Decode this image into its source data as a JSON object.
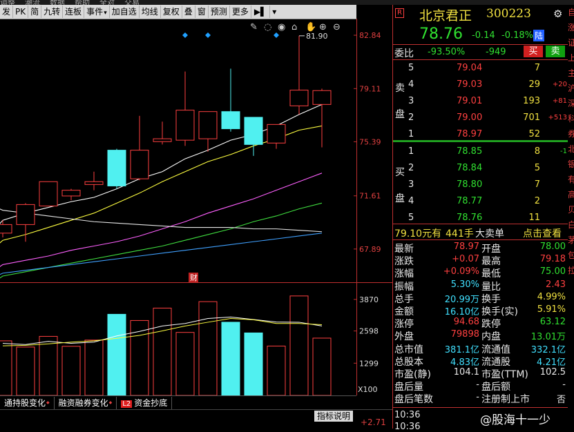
{
  "menubar": [
    "调整",
    "潮流",
    "数据",
    "帮助",
    "全对",
    "交易"
  ],
  "toolbar": {
    "items": [
      "发",
      "PK",
      "简",
      "九转",
      "连板",
      "事件",
      "加自选",
      "均线",
      "复权",
      "叠",
      "窗",
      "预测",
      "更多"
    ],
    "dropdown_items": [
      "事件"
    ]
  },
  "chart_data": {
    "type": "candlestick",
    "price_axis": {
      "ticks": [
        82.84,
        79.11,
        75.39,
        71.61,
        67.89
      ],
      "range": [
        66,
        84
      ]
    },
    "candles": [
      {
        "o": 69.0,
        "h": 69.9,
        "l": 68.7,
        "c": 69.6
      },
      {
        "o": 69.6,
        "h": 71.1,
        "l": 68.4,
        "c": 71.0
      },
      {
        "o": 70.9,
        "h": 72.6,
        "l": 70.9,
        "c": 72.6
      },
      {
        "o": 71.6,
        "h": 72.1,
        "l": 71.3,
        "c": 72.0
      },
      {
        "o": 72.4,
        "h": 73.3,
        "l": 72.0,
        "c": 72.6
      },
      {
        "o": 74.8,
        "h": 74.9,
        "l": 72.1,
        "c": 72.3
      },
      {
        "o": 72.8,
        "h": 77.2,
        "l": 72.7,
        "c": 74.8
      },
      {
        "o": 75.4,
        "h": 76.8,
        "l": 75.2,
        "c": 75.6
      },
      {
        "o": 75.5,
        "h": 80.3,
        "l": 75.1,
        "c": 77.6
      },
      {
        "o": 75.6,
        "h": 77.4,
        "l": 74.7,
        "c": 77.5
      },
      {
        "o": 77.5,
        "h": 80.5,
        "l": 76.1,
        "c": 76.3
      },
      {
        "o": 77.1,
        "h": 77.1,
        "l": 74.4,
        "c": 75.2
      },
      {
        "o": 75.3,
        "h": 76.5,
        "l": 74.9,
        "c": 76.6
      },
      {
        "o": 77.9,
        "h": 82.8,
        "l": 77.3,
        "c": 79.0
      },
      {
        "o": 78.0,
        "h": 79.1,
        "l": 75.0,
        "c": 78.97
      }
    ],
    "high_annotation": "81.90",
    "ma_lines": [
      {
        "color": "#ffffff",
        "values": [
          69.9,
          70.4,
          70.8,
          71.2,
          71.5,
          72.1,
          72.8,
          73.3,
          74.2,
          74.8,
          75.5,
          75.9,
          76.5,
          77.3,
          78.0
        ]
      },
      {
        "color": "#ffff40",
        "values": [
          68.5,
          68.9,
          69.4,
          69.9,
          70.4,
          71.1,
          71.8,
          72.6,
          73.3,
          74.0,
          74.5,
          75.1,
          75.6,
          76.2,
          76.5
        ]
      },
      {
        "color": "#ff60ff",
        "values": [
          66.8,
          67.1,
          67.4,
          67.8,
          68.1,
          68.4,
          68.8,
          69.3,
          69.8,
          70.4,
          70.9,
          71.4,
          72.0,
          72.6,
          73.2
        ]
      },
      {
        "color": "#40e040",
        "values": [
          66.0,
          66.3,
          66.6,
          66.9,
          67.2,
          67.5,
          67.8,
          68.1,
          68.5,
          68.9,
          69.3,
          69.8,
          70.2,
          70.7,
          71.1
        ]
      },
      {
        "color": "#e8e8e8",
        "values": [
          70.6,
          70.4,
          70.2,
          70.0,
          69.8,
          69.7,
          69.6,
          69.5,
          69.4,
          69.4,
          69.4,
          69.3,
          69.3,
          69.2,
          69.1
        ]
      },
      {
        "color": "#40a0ff",
        "values": [
          66.2,
          66.4,
          66.6,
          66.8,
          67.0,
          67.2,
          67.4,
          67.6,
          67.8,
          68.0,
          68.2,
          68.4,
          68.6,
          68.8,
          69.0
        ]
      }
    ],
    "volume_axis": {
      "ticks": [
        3870,
        2598,
        1299
      ],
      "range": [
        0,
        4200
      ],
      "unit": "X100"
    },
    "volumes": [
      2200,
      1950,
      2380,
      1980,
      2230,
      3270,
      3020,
      3520,
      2540,
      3780,
      2950,
      2520,
      1990,
      4010,
      2310
    ],
    "vol_ma": [
      {
        "color": "#ffffff",
        "values": [
          2100,
          2050,
          2180,
          2100,
          2150,
          2400,
          2580,
          2800,
          2900,
          3100,
          3160,
          3060,
          2960,
          2950,
          2800
        ]
      },
      {
        "color": "#ffff40",
        "values": [
          2000,
          2020,
          2080,
          2150,
          2200,
          2300,
          2420,
          2600,
          2800,
          2950,
          3100,
          3050,
          2900,
          2900,
          2850
        ]
      }
    ],
    "markers": {
      "diamonds_at": [
        8,
        9,
        12
      ],
      "cai_label": "财"
    }
  },
  "chart_icons": [
    "pencil-icon",
    "lasso-icon",
    "eye-icon",
    "lock-icon",
    "hand-icon",
    "zoom-in-icon",
    "zoom-out-icon"
  ],
  "tabs": [
    "通持股变化",
    "融资融券变化",
    "资金抄底"
  ],
  "tabs_l2": "L2",
  "index_button": "指标说明",
  "bottom_value": "+2.71",
  "quote": {
    "r_badge": "R",
    "name": "北京君正",
    "code": "300223",
    "price": "78.76",
    "change": "-0.14",
    "change_pct": "-0.18%",
    "exchange_tag": "陆",
    "weibi_label": "委比",
    "weibi_pct": "-93.50%",
    "weibi_val": "-949",
    "buy_btn": "买",
    "sell_btn": "卖",
    "sell_side_label": [
      "卖",
      "盘"
    ],
    "buy_side_label": [
      "买",
      "盘"
    ],
    "asks": [
      {
        "lvl": "5",
        "price": "79.04",
        "vol": "7",
        "chg": ""
      },
      {
        "lvl": "4",
        "price": "79.03",
        "vol": "29",
        "chg": "+20"
      },
      {
        "lvl": "3",
        "price": "79.01",
        "vol": "193",
        "chg": "+81"
      },
      {
        "lvl": "2",
        "price": "79.00",
        "vol": "701",
        "chg": "+513"
      },
      {
        "lvl": "1",
        "price": "78.97",
        "vol": "52",
        "chg": ""
      }
    ],
    "bids": [
      {
        "lvl": "1",
        "price": "78.85",
        "vol": "8",
        "chg": "-1"
      },
      {
        "lvl": "2",
        "price": "78.84",
        "vol": "5",
        "chg": ""
      },
      {
        "lvl": "3",
        "price": "78.80",
        "vol": "7",
        "chg": ""
      },
      {
        "lvl": "4",
        "price": "78.77",
        "vol": "2",
        "chg": ""
      },
      {
        "lvl": "5",
        "price": "78.76",
        "vol": "11",
        "chg": ""
      }
    ],
    "big_order": {
      "price": "79.10元有",
      "vol": "441手",
      "text": "大卖单",
      "link": "点击查看"
    },
    "stats": [
      {
        "l1": "最新",
        "v1": "78.97",
        "c1": "red",
        "l2": "开盘",
        "v2": "78.00",
        "c2": "green"
      },
      {
        "l1": "涨跌",
        "v1": "+0.07",
        "c1": "red",
        "l2": "最高",
        "v2": "79.18",
        "c2": "red"
      },
      {
        "l1": "涨幅",
        "v1": "+0.09%",
        "c1": "red",
        "l2": "最低",
        "v2": "75.00",
        "c2": "green"
      },
      {
        "l1": "振幅",
        "v1": "5.30%",
        "c1": "cyan",
        "l2": "量比",
        "v2": "2.43",
        "c2": "red"
      },
      {
        "l1": "总手",
        "v1": "20.99万",
        "c1": "cyan",
        "l2": "换手",
        "v2": "4.99%",
        "c2": "yellow"
      },
      {
        "l1": "金额",
        "v1": "16.10亿",
        "c1": "cyan",
        "l2": "换手(实)",
        "v2": "5.91%",
        "c2": "yellow"
      },
      {
        "l1": "涨停",
        "v1": "94.68",
        "c1": "red",
        "l2": "跌停",
        "v2": "63.12",
        "c2": "green"
      },
      {
        "l1": "外盘",
        "v1": "79898",
        "c1": "red",
        "l2": "内盘",
        "v2": "13.01万",
        "c2": "green"
      },
      {
        "l1": "总市值",
        "v1": "381.1亿",
        "c1": "cyan",
        "l2": "流通值",
        "v2": "332.1亿",
        "c2": "cyan"
      },
      {
        "l1": "总股本",
        "v1": "4.83亿",
        "c1": "cyan",
        "l2": "流通股",
        "v2": "4.21亿",
        "c2": "cyan"
      },
      {
        "l1": "市盈(静)",
        "v1": "104.1",
        "c1": "white",
        "l2": "市盈(TTM)",
        "v2": "102.5",
        "c2": "white"
      },
      {
        "l1": "盘后量",
        "v1": "-",
        "c1": "white",
        "l2": "盘后额",
        "v2": "-",
        "c2": "white"
      },
      {
        "l1": "盘后笔数",
        "v1": "-",
        "c1": "white",
        "l2": "注册制上市",
        "v2": "否",
        "c2": "white"
      }
    ],
    "time_rows": [
      "10:36",
      "10:36"
    ],
    "watermark": "@股海十一少"
  },
  "far_right_chars": [
    "自",
    "涨",
    "证",
    "上",
    "主",
    "沪",
    "深",
    "科",
    "券",
    "北",
    "银",
    "有",
    "高",
    "贝",
    "白",
    "茅",
    "包",
    "拉"
  ]
}
